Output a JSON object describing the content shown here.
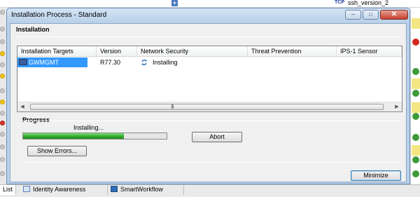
{
  "background": {
    "top_bar": {
      "protocol_badge": "TCP",
      "service_name": "ssh_version_2"
    },
    "bottom_tabs": [
      {
        "label": "List"
      },
      {
        "label": "Identity Awareness"
      },
      {
        "label": "SmartWorkflow"
      }
    ]
  },
  "dialog": {
    "title": "Installation Process  - Standard",
    "installation_section": "Installation",
    "table": {
      "columns": [
        "Installation Targets",
        "Version",
        "Network Security",
        "Threat Prevention",
        "IPS-1 Sensor"
      ],
      "rows": [
        {
          "target": "GWMGMT",
          "version": "R77.30",
          "network_security": "Installing",
          "threat_prevention": "",
          "ips1_sensor": ""
        }
      ],
      "scroll_grip": "III"
    },
    "progress_section": "Progress",
    "progress": {
      "status_text": "Installing...",
      "fraction": 0.7
    },
    "buttons": {
      "abort": "Abort",
      "show_errors": "Show Errors...",
      "minimize": "Minimize"
    },
    "window_controls": {
      "minimize": "–",
      "restore": "□",
      "close": "✕"
    },
    "colors": {
      "progress_fill": "#2ea52a",
      "selection": "#3399ff"
    }
  }
}
